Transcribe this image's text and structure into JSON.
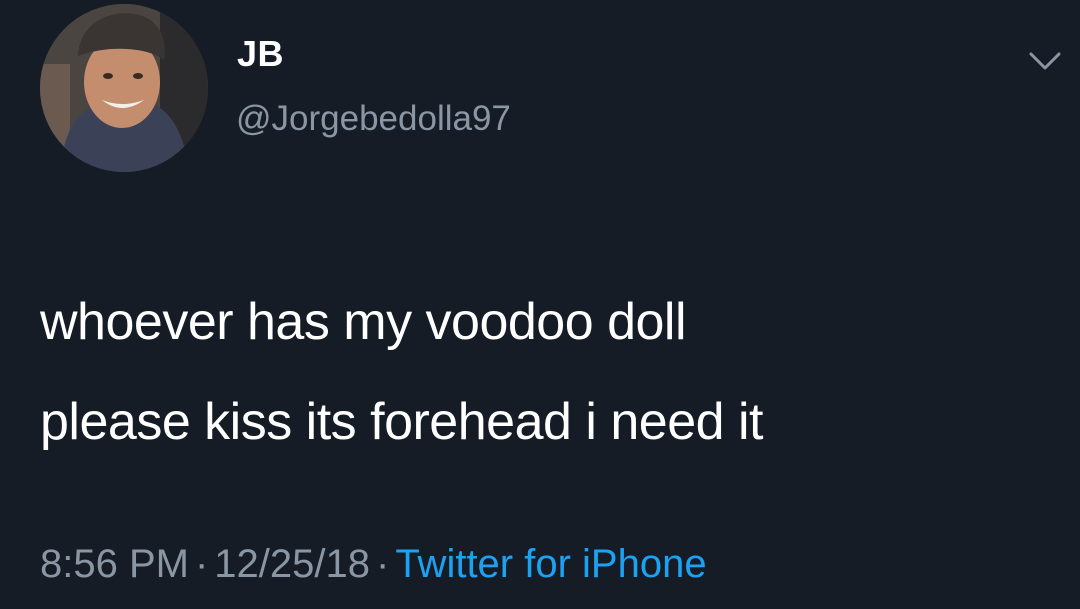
{
  "author": {
    "display_name": "JB",
    "handle": "@Jorgebedolla97"
  },
  "tweet": {
    "text_lines": [
      "whoever has my voodoo doll",
      "please kiss its forehead i need it"
    ],
    "time": "8:56 PM",
    "date": "12/25/18",
    "source": "Twitter for iPhone",
    "separator": "·"
  },
  "colors": {
    "background": "#151c26",
    "primary_text": "#ffffff",
    "secondary_text": "#8a96a3",
    "link": "#1da1f2"
  },
  "icons": {
    "menu": "chevron-down-icon"
  }
}
